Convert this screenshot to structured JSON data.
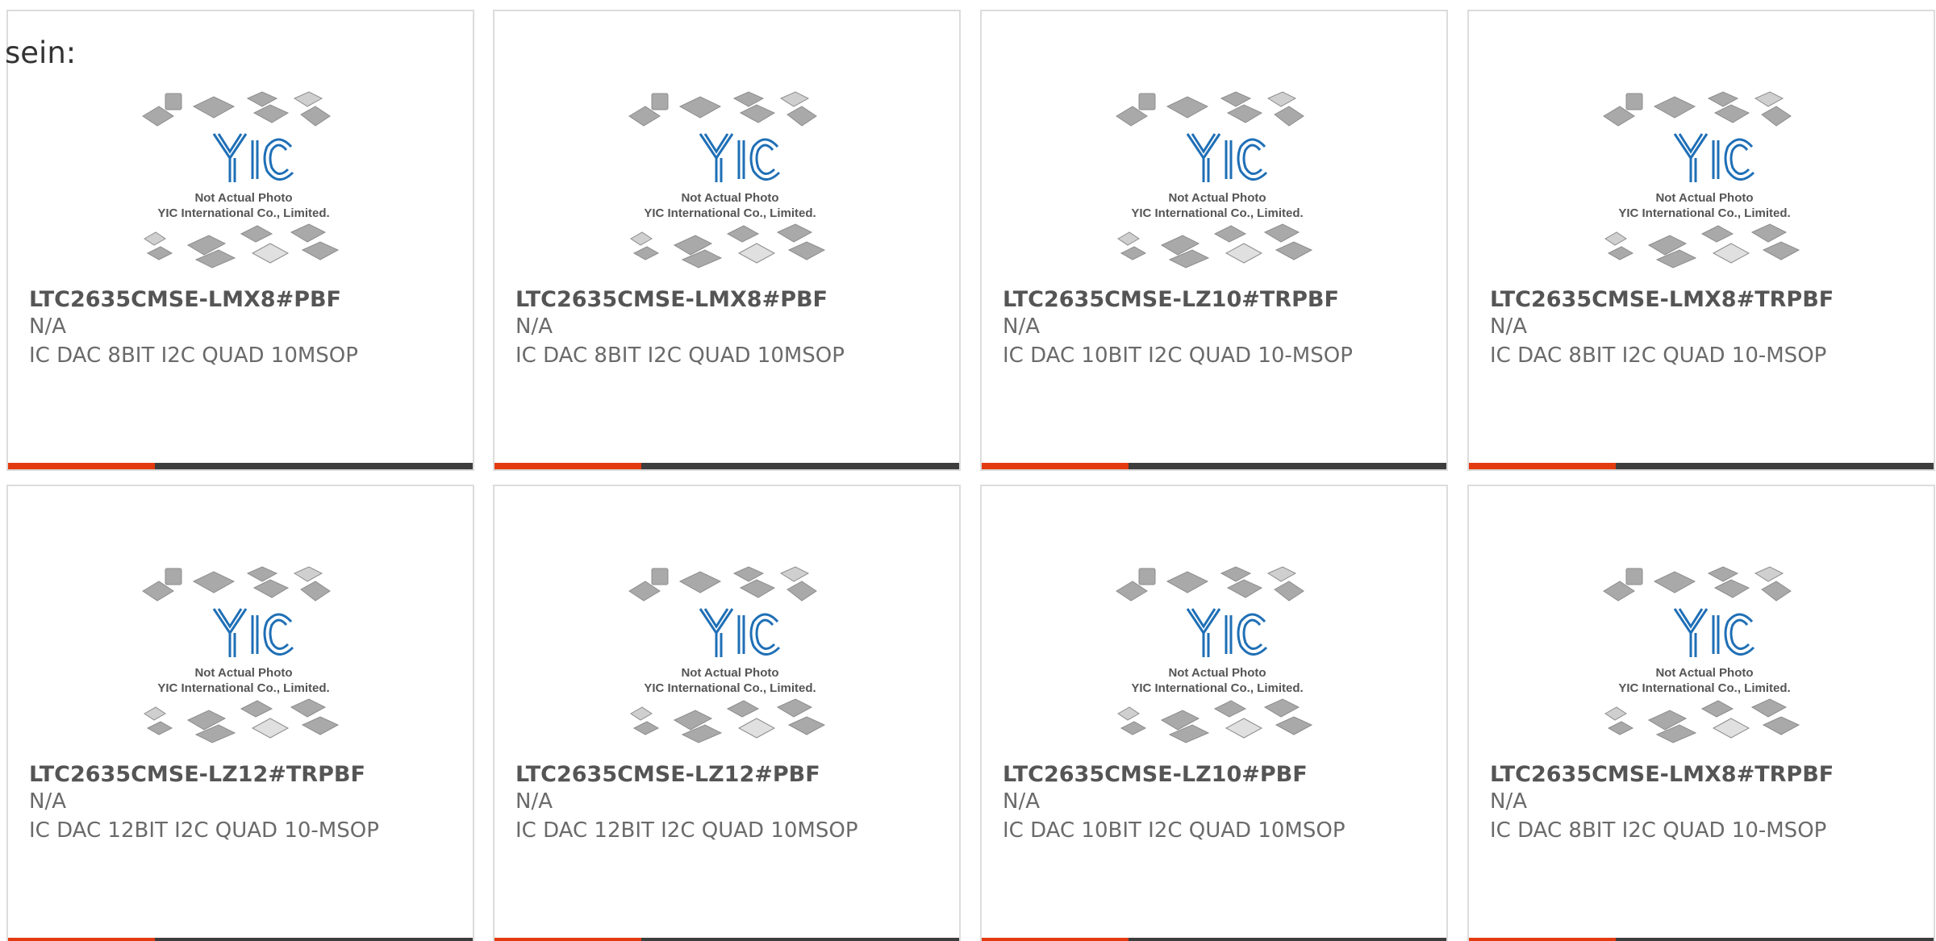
{
  "heading": "sein:",
  "colors": {
    "accent": "#e33a0f",
    "dark": "#3d3d3d"
  },
  "watermark": {
    "line1": "Not Actual Photo",
    "line2": "YIC International Co., Limited.",
    "logo": "YIC"
  },
  "products": [
    {
      "part": "LTC2635CMSE-LMX8#PBF",
      "mfr": "N/A",
      "desc": "IC DAC 8BIT I2C QUAD 10MSOP"
    },
    {
      "part": "LTC2635CMSE-LMX8#PBF",
      "mfr": "N/A",
      "desc": "IC DAC 8BIT I2C QUAD 10MSOP"
    },
    {
      "part": "LTC2635CMSE-LZ10#TRPBF",
      "mfr": "N/A",
      "desc": "IC DAC 10BIT I2C QUAD 10-MSOP"
    },
    {
      "part": "LTC2635CMSE-LMX8#TRPBF",
      "mfr": "N/A",
      "desc": "IC DAC 8BIT I2C QUAD 10-MSOP"
    },
    {
      "part": "LTC2635CMSE-LZ12#TRPBF",
      "mfr": "N/A",
      "desc": "IC DAC 12BIT I2C QUAD 10-MSOP"
    },
    {
      "part": "LTC2635CMSE-LZ12#PBF",
      "mfr": "N/A",
      "desc": "IC DAC 12BIT I2C QUAD 10MSOP"
    },
    {
      "part": "LTC2635CMSE-LZ10#PBF",
      "mfr": "N/A",
      "desc": "IC DAC 10BIT I2C QUAD 10MSOP"
    },
    {
      "part": "LTC2635CMSE-LMX8#TRPBF",
      "mfr": "N/A",
      "desc": "IC DAC 8BIT I2C QUAD 10-MSOP"
    }
  ]
}
